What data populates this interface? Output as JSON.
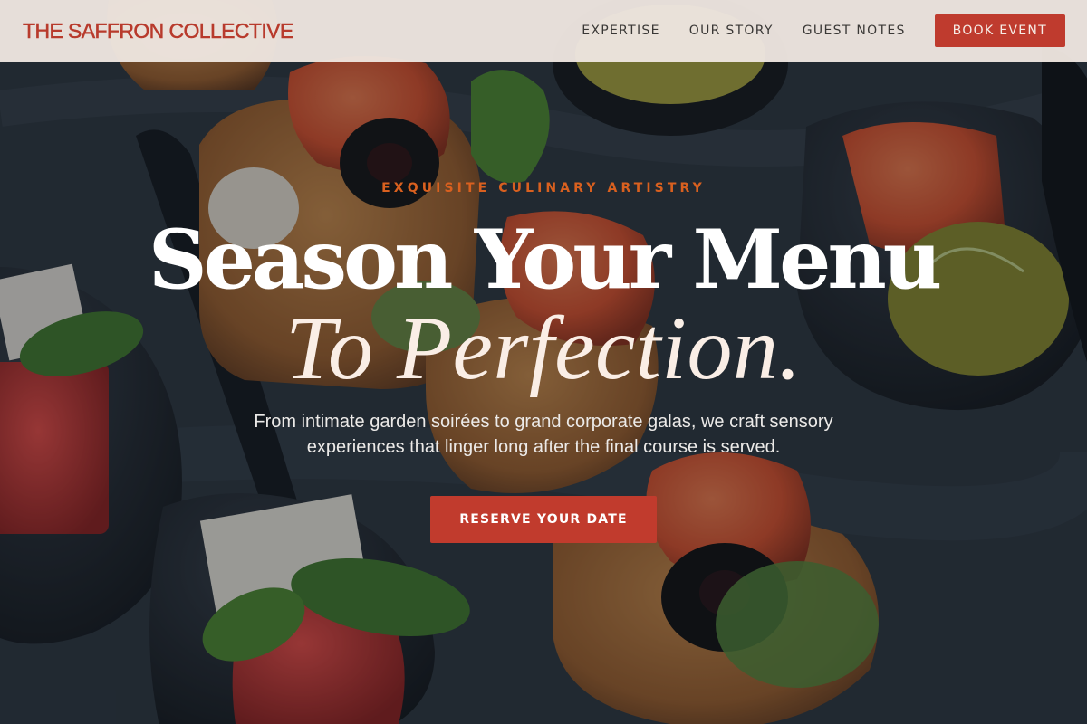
{
  "header": {
    "brand": "THE SAFFRON COLLECTIVE",
    "nav": [
      {
        "label": "EXPERTISE"
      },
      {
        "label": "OUR STORY"
      },
      {
        "label": "GUEST NOTES"
      }
    ],
    "book_button": "BOOK EVENT"
  },
  "hero": {
    "eyebrow": "EXQUISITE CULINARY ARTISTRY",
    "headline_line1": "Season Your Menu",
    "headline_line2": "To Perfection.",
    "subtext": "From intimate garden soirées to grand corporate galas, we craft sensory experiences that linger long after the final course is served.",
    "cta_button": "RESERVE YOUR DATE",
    "background_image": "catering-canapes-photo"
  },
  "colors": {
    "brand_red": "#b83a2c",
    "button_red": "#c13b2d",
    "eyebrow_orange": "#d9601f",
    "header_bg": "#eee6e0"
  }
}
